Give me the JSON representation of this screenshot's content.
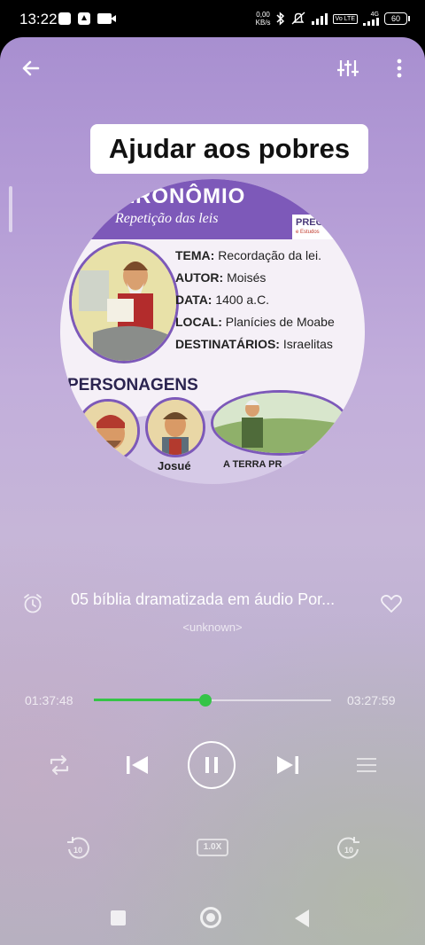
{
  "status_bar": {
    "time": "13:22",
    "net_speed_value": "0,00",
    "net_speed_unit": "KB/s",
    "volte": "Vo LTE",
    "network": "4G",
    "battery": "60"
  },
  "header": {
    "back_icon": "arrow-left-icon",
    "equalizer_icon": "equalizer-icon",
    "more_icon": "more-vertical-icon"
  },
  "lyric": {
    "text": "Ajudar aos pobres"
  },
  "artwork": {
    "title": "ERONÔMIO",
    "subtitle": "Repetição das leis",
    "brand": "PREG",
    "brand_sub": "e Estudos",
    "info": [
      {
        "label": "TEMA:",
        "value": "Recordação da lei."
      },
      {
        "label": "AUTOR:",
        "value": "Moisés"
      },
      {
        "label": "DATA:",
        "value": "1400 a.C."
      },
      {
        "label": "LOCAL:",
        "value": "Planícies de Moabe"
      },
      {
        "label": "DESTINATÁRIOS:",
        "value": "Israelitas"
      }
    ],
    "personagens": "PERSONAGENS",
    "caption_1": "Josué",
    "caption_2": "A TERRA PR"
  },
  "song": {
    "title": "05 bíblia dramatizada em áudio Por...",
    "artist": "<unknown>"
  },
  "progress": {
    "elapsed": "01:37:48",
    "total": "03:27:59",
    "fraction": 0.47,
    "accent_color": "#35c447"
  },
  "controls": {
    "repeat_icon": "repeat-icon",
    "prev_icon": "skip-previous-icon",
    "pause_icon": "pause-icon",
    "next_icon": "skip-next-icon",
    "queue_icon": "queue-list-icon"
  },
  "extra": {
    "rewind_label": "10",
    "speed_label": "1.0X",
    "forward_label": "10"
  }
}
